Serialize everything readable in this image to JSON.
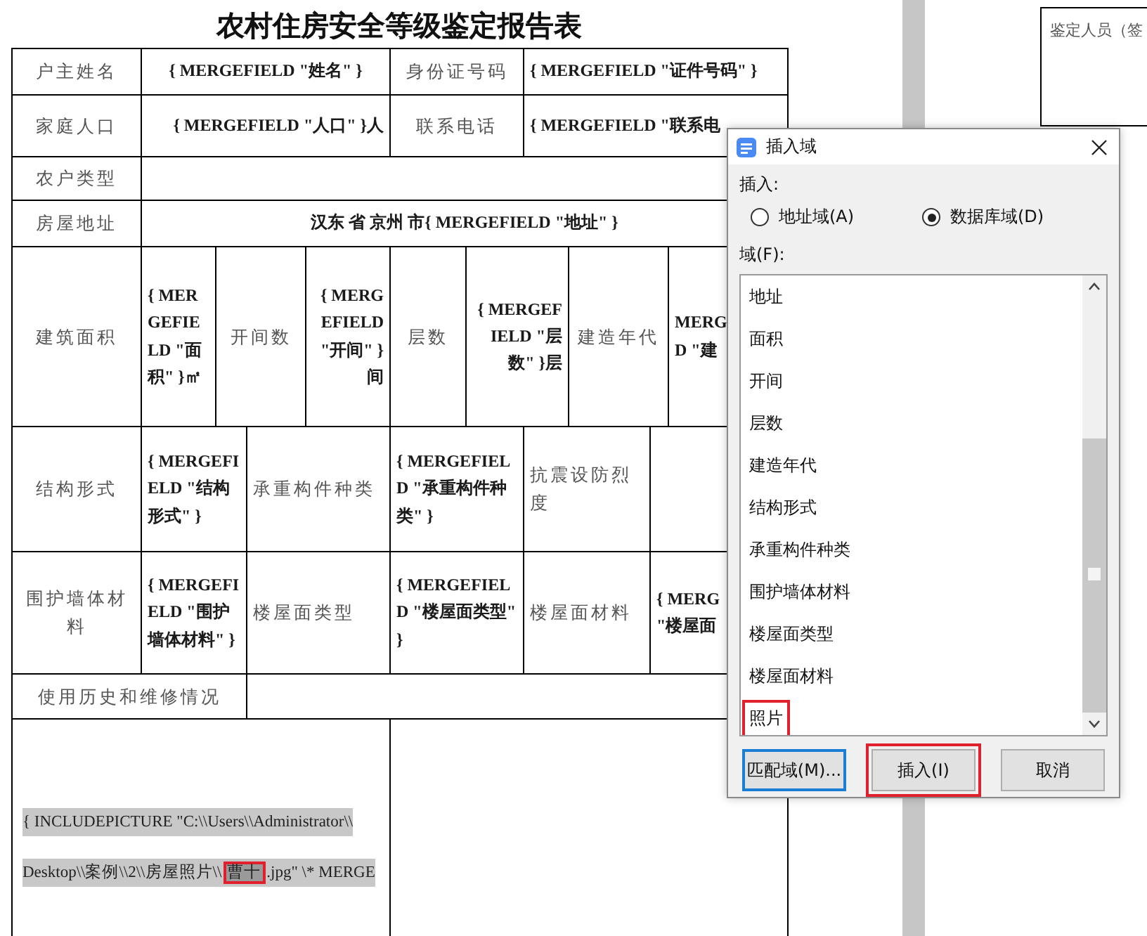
{
  "document": {
    "title": "农村住房安全等级鉴定报告表",
    "rows": [
      [
        {
          "kind": "label",
          "text": "户主姓名"
        },
        {
          "kind": "field",
          "text": "{ MERGEFIELD \"姓名\" }",
          "colspan": 4
        },
        {
          "kind": "label",
          "text": "身份证号码",
          "colspan": 2
        },
        {
          "kind": "field",
          "text": "{ MERGEFIELD \"证件号码\" }",
          "colspan": 4
        }
      ],
      [
        {
          "kind": "label",
          "text": "家庭人口"
        },
        {
          "kind": "field",
          "text": "{ MERGEFIELD \"人口\" }人",
          "colspan": 4
        },
        {
          "kind": "label",
          "text": "联系电话",
          "colspan": 2
        },
        {
          "kind": "field",
          "text": "{ MERGEFIELD \"联系电",
          "colspan": 4
        }
      ],
      [
        {
          "kind": "label",
          "text": "农户类型"
        },
        {
          "kind": "empty",
          "colspan": 10
        }
      ],
      [
        {
          "kind": "label",
          "text": "房屋地址"
        },
        {
          "kind": "field",
          "text": "汉东 省 京州 市{ MERGEFIELD \"地址\" }",
          "colspan": 10
        }
      ],
      [
        {
          "kind": "label",
          "text": "建筑面积"
        },
        {
          "kind": "field",
          "text": "{ MERGEFIELD \"面积\" }㎡"
        },
        {
          "kind": "label",
          "text": "开间数",
          "colspan": 2
        },
        {
          "kind": "field",
          "text": "{ MERGEFIELD \"开间\" }间"
        },
        {
          "kind": "label",
          "text": "层数"
        },
        {
          "kind": "field",
          "text": "{ MERGEFIELD \"层数\" }层",
          "colspan": 2
        },
        {
          "kind": "label",
          "text": "建造年代",
          "colspan": 2
        },
        {
          "kind": "field",
          "text": "MERG\nD \"建"
        }
      ],
      [
        {
          "kind": "label",
          "text": "结构形式"
        },
        {
          "kind": "field",
          "text": "{ MERGEFIELD \"结构形式\" }",
          "colspan": 2
        },
        {
          "kind": "label",
          "text": "承重构件种类",
          "colspan": 2
        },
        {
          "kind": "field",
          "text": "{ MERGEFIELD \"承重构件种类\" }",
          "colspan": 2
        },
        {
          "kind": "label",
          "text": "抗震设防烈度",
          "colspan": 2
        },
        {
          "kind": "empty",
          "colspan": 2
        }
      ],
      [
        {
          "kind": "label",
          "text": "围护墙体材料"
        },
        {
          "kind": "field",
          "text": "{ MERGEFIELD \"围护墙体材料\" }",
          "colspan": 2
        },
        {
          "kind": "label",
          "text": "楼屋面类型",
          "colspan": 2
        },
        {
          "kind": "field",
          "text": "{ MERGEFIELD \"楼屋面类型\" }",
          "colspan": 2
        },
        {
          "kind": "label",
          "text": "楼屋面材料",
          "colspan": 2
        },
        {
          "kind": "field",
          "text": "{ MERG\n\"楼屋面",
          "colspan": 2
        }
      ],
      [
        {
          "kind": "label",
          "text": "使用历史和维修情况",
          "colspan": 3
        },
        {
          "kind": "empty",
          "colspan": 8
        }
      ],
      [
        {
          "kind": "code",
          "colspan": 5,
          "lines": [
            [
              {
                "text": "{ INCLUDEPICTURE \"C:\\\\Users\\\\Administrator\\\\",
                "marked": false
              }
            ],
            [
              {
                "text": "Desktop\\\\案例\\\\2\\\\房屋照片\\\\",
                "marked": false
              },
              {
                "text": "曹十",
                "marked": true
              },
              {
                "text": ".jpg\" \\* MERGE",
                "marked": false
              }
            ]
          ]
        },
        {
          "kind": "empty",
          "colspan": 6
        }
      ]
    ]
  },
  "side_page": {
    "text": "鉴定人员（签"
  },
  "dialog": {
    "title": "插入域",
    "insert_label": "插入:",
    "options": [
      {
        "label": "地址域(A)",
        "selected": false
      },
      {
        "label": "数据库域(D)",
        "selected": true
      }
    ],
    "fields_label": "域(F):",
    "fields": [
      {
        "label": "地址",
        "marked": false
      },
      {
        "label": "面积",
        "marked": false
      },
      {
        "label": "开间",
        "marked": false
      },
      {
        "label": "层数",
        "marked": false
      },
      {
        "label": "建造年代",
        "marked": false
      },
      {
        "label": "结构形式",
        "marked": false
      },
      {
        "label": "承重构件种类",
        "marked": false
      },
      {
        "label": "围护墙体材料",
        "marked": false
      },
      {
        "label": "楼屋面类型",
        "marked": false
      },
      {
        "label": "楼屋面材料",
        "marked": false
      },
      {
        "label": "照片",
        "marked": true
      }
    ],
    "buttons": [
      {
        "label": "匹配域(M)...",
        "focused": true,
        "marked": false
      },
      {
        "label": "插入(I)",
        "focused": false,
        "marked": true
      },
      {
        "label": "取消",
        "focused": false,
        "marked": false
      }
    ]
  }
}
